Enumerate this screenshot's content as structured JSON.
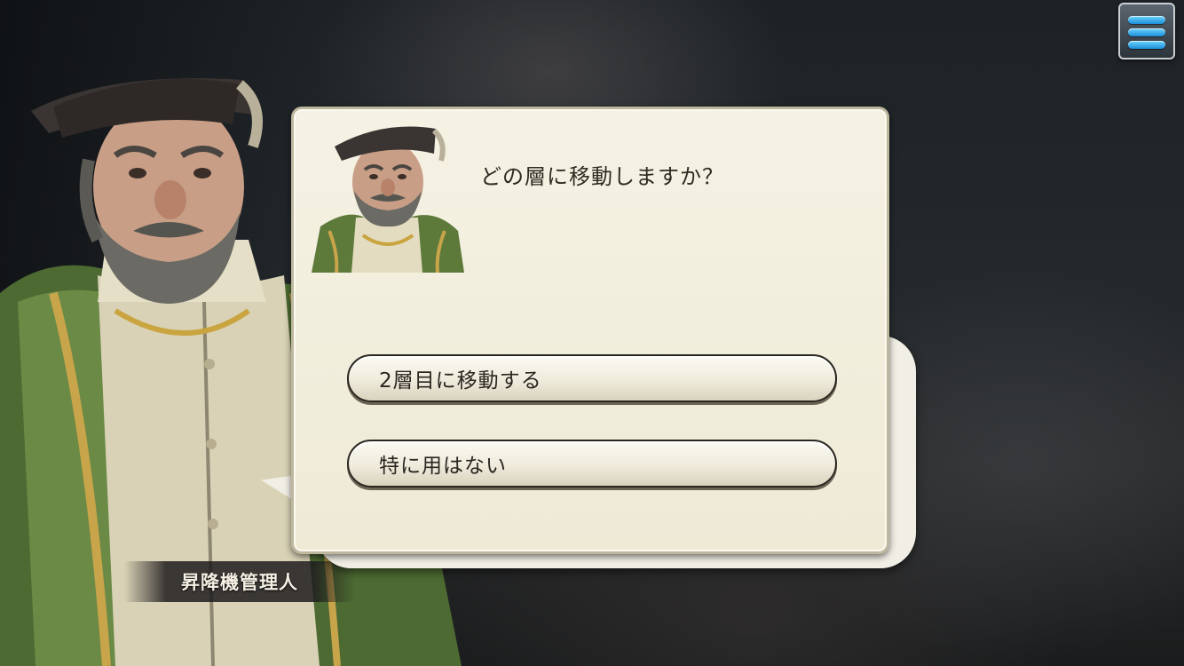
{
  "header": {
    "menu_icon": "hamburger-menu-icon"
  },
  "speaker": {
    "name": "昇降機管理人"
  },
  "dialog": {
    "question": "どの層に移動しますか？",
    "choices": [
      {
        "label": "2層目に移動する"
      },
      {
        "label": "特に用はない"
      }
    ]
  },
  "colors": {
    "panel": "#f5f2e4",
    "panel_border": "#bdb79e",
    "text": "#2e2a22",
    "menu_bar": "#1b8fd9",
    "coat_green": "#5d7a3a",
    "hat": "#3a3432"
  }
}
